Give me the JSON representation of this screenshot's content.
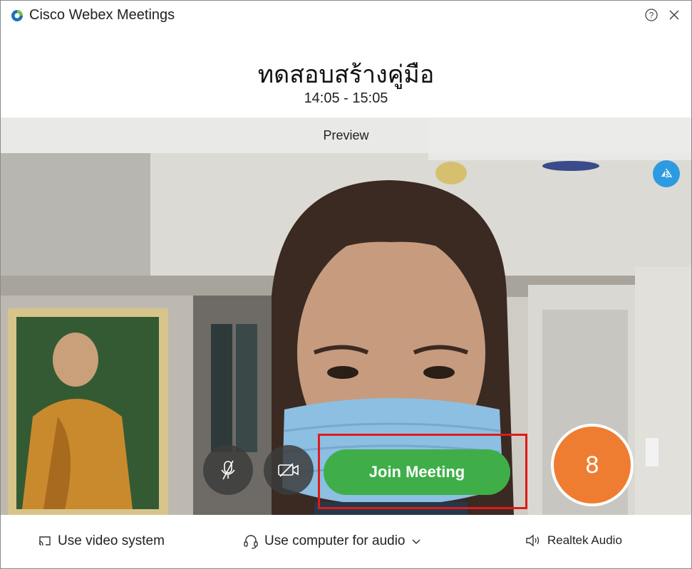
{
  "titlebar": {
    "app_name": "Cisco Webex Meetings",
    "logo_icon": "webex-logo-icon",
    "help_icon": "help-icon",
    "close_icon": "close-icon"
  },
  "meeting": {
    "title": "ทดสอบสร้างคู่มือ",
    "time": "14:05 - 15:05"
  },
  "preview": {
    "label": "Preview",
    "mirror_icon": "mirror-icon"
  },
  "controls": {
    "mute_icon": "microphone-muted-icon",
    "video_icon": "video-off-icon",
    "join_label": "Join Meeting"
  },
  "annotation": {
    "step_number": "8",
    "highlight_color": "#e01b1b",
    "badge_color": "#ef7d31"
  },
  "bottombar": {
    "video_system_label": "Use video system",
    "audio_label": "Use computer for audio",
    "speaker_label": "Realtek Audio"
  },
  "colors": {
    "join_green": "#3fae49",
    "mirror_blue": "#2d9be2"
  }
}
